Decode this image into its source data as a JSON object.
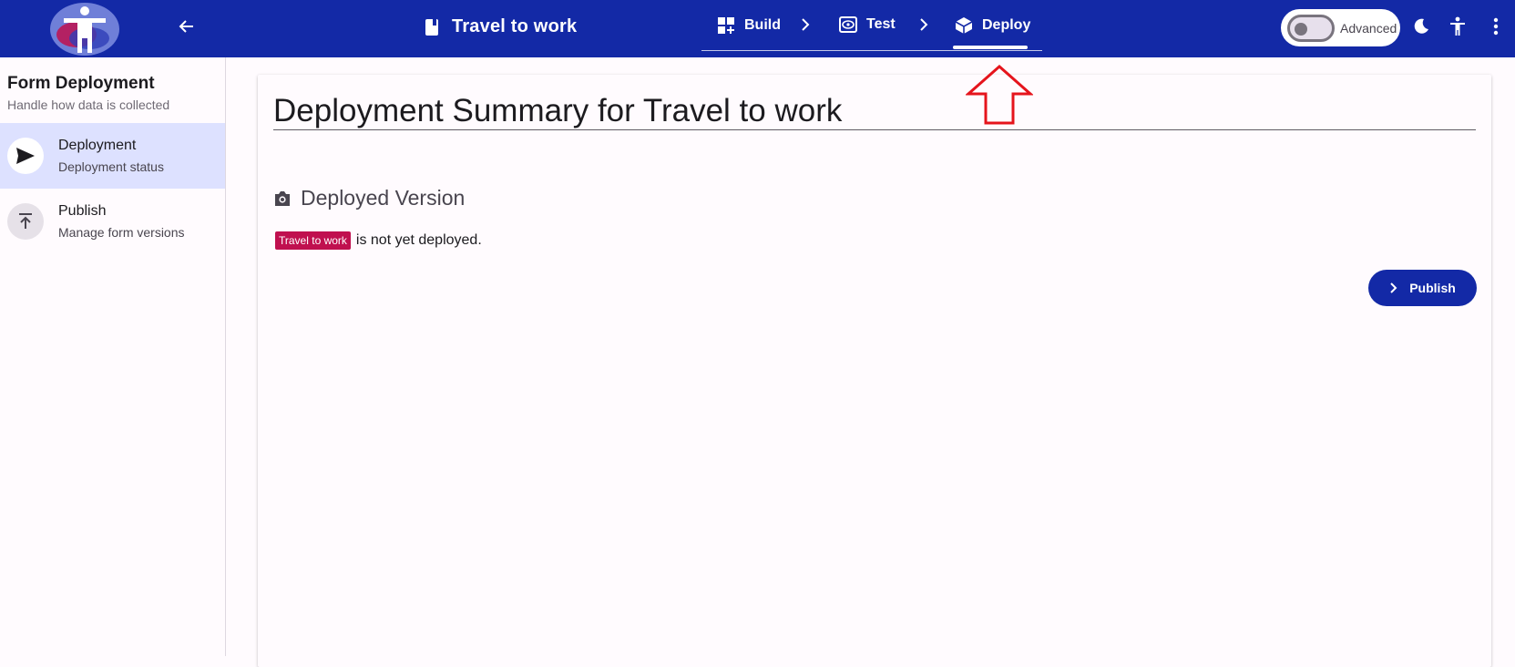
{
  "header": {
    "form_title": "Travel to work",
    "steps": [
      {
        "label": "Build",
        "icon": "build-grid-icon"
      },
      {
        "label": "Test",
        "icon": "eye-icon"
      },
      {
        "label": "Deploy",
        "icon": "package-icon"
      }
    ],
    "active_step": "Deploy",
    "advanced_label": "Advanced",
    "colors": {
      "bar": "#1329a6",
      "accent": "#c0104f"
    }
  },
  "sidebar": {
    "title": "Form Deployment",
    "subtitle": "Handle how data is collected",
    "items": [
      {
        "label": "Deployment",
        "desc": "Deployment status",
        "icon": "send-icon"
      },
      {
        "label": "Publish",
        "desc": "Manage form versions",
        "icon": "upload-icon"
      }
    ]
  },
  "main": {
    "title": "Deployment Summary for Travel to work",
    "section_title": "Deployed Version",
    "badge": "Travel to work",
    "status_text": "is not yet deployed.",
    "publish_label": "Publish"
  }
}
